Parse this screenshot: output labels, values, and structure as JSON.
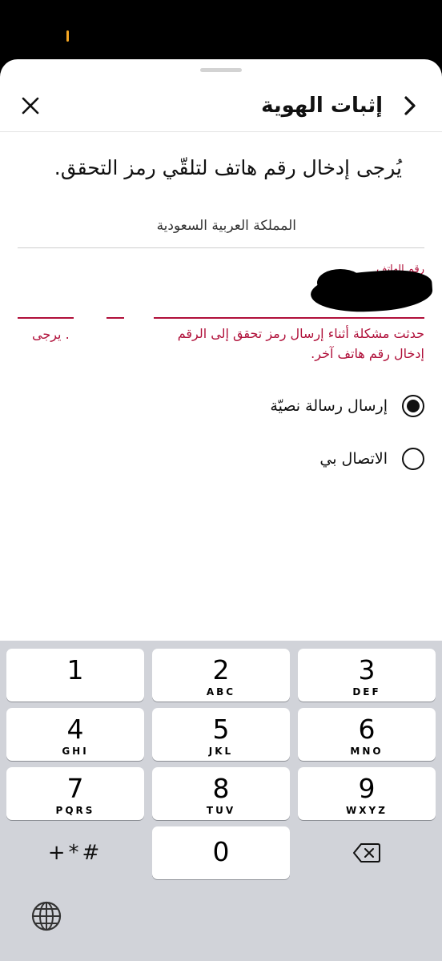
{
  "header": {
    "title": "إثبات الهوية",
    "back_icon": "chevron-right-icon",
    "close_icon": "close-icon"
  },
  "instruction": "يُرجى إدخال رقم هاتف لتلقّي رمز التحقق.",
  "country": {
    "value": "المملكة العربية السعودية"
  },
  "phone": {
    "label": "رقم الهاتف"
  },
  "error": {
    "line1": "حدثت مشكلة أثناء إرسال رمز تحقق إلى الرقم",
    "fragment": ". يرجى",
    "line2": "إدخال رقم هاتف آخر."
  },
  "options": [
    {
      "label": "إرسال رسالة نصيّة",
      "selected": true
    },
    {
      "label": "الاتصال بي",
      "selected": false
    }
  ],
  "keypad": {
    "keys": [
      {
        "digit": "1",
        "letters": ""
      },
      {
        "digit": "2",
        "letters": "ABC"
      },
      {
        "digit": "3",
        "letters": "DEF"
      },
      {
        "digit": "4",
        "letters": "GHI"
      },
      {
        "digit": "5",
        "letters": "JKL"
      },
      {
        "digit": "6",
        "letters": "MNO"
      },
      {
        "digit": "7",
        "letters": "PQRS"
      },
      {
        "digit": "8",
        "letters": "TUV"
      },
      {
        "digit": "9",
        "letters": "WXYZ"
      },
      {
        "digit": "0",
        "letters": ""
      }
    ],
    "symbols": "+*#",
    "delete_icon": "backspace-icon",
    "globe_icon": "globe-icon"
  },
  "colors": {
    "error": "#b0103a",
    "keyboard_bg": "#d1d3d9",
    "accent_status": "#f5a623"
  }
}
